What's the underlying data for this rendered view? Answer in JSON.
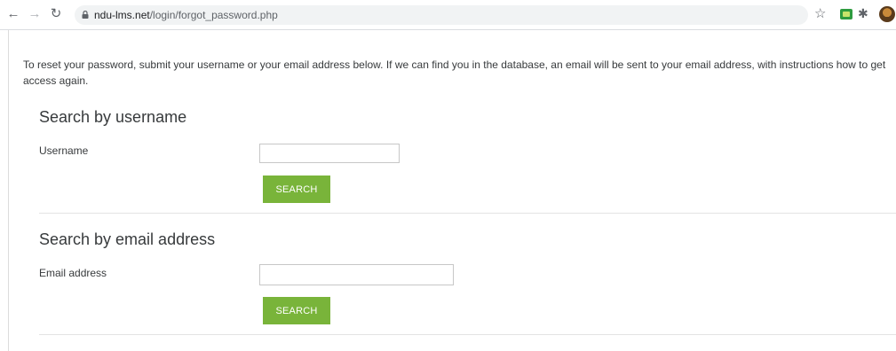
{
  "browser": {
    "url_host": "ndu-lms.net",
    "url_path": "/login/forgot_password.php"
  },
  "intro_text": "To reset your password, submit your username or your email address below. If we can find you in the database, an email will be sent to your email address, with instructions how to get access again.",
  "username_section": {
    "title": "Search by username",
    "field_label": "Username",
    "input_value": "",
    "button_label": "SEARCH"
  },
  "email_section": {
    "title": "Search by email address",
    "field_label": "Email address",
    "input_value": "",
    "button_label": "SEARCH"
  },
  "colors": {
    "button": "#79b43a",
    "text": "#373a3c"
  }
}
